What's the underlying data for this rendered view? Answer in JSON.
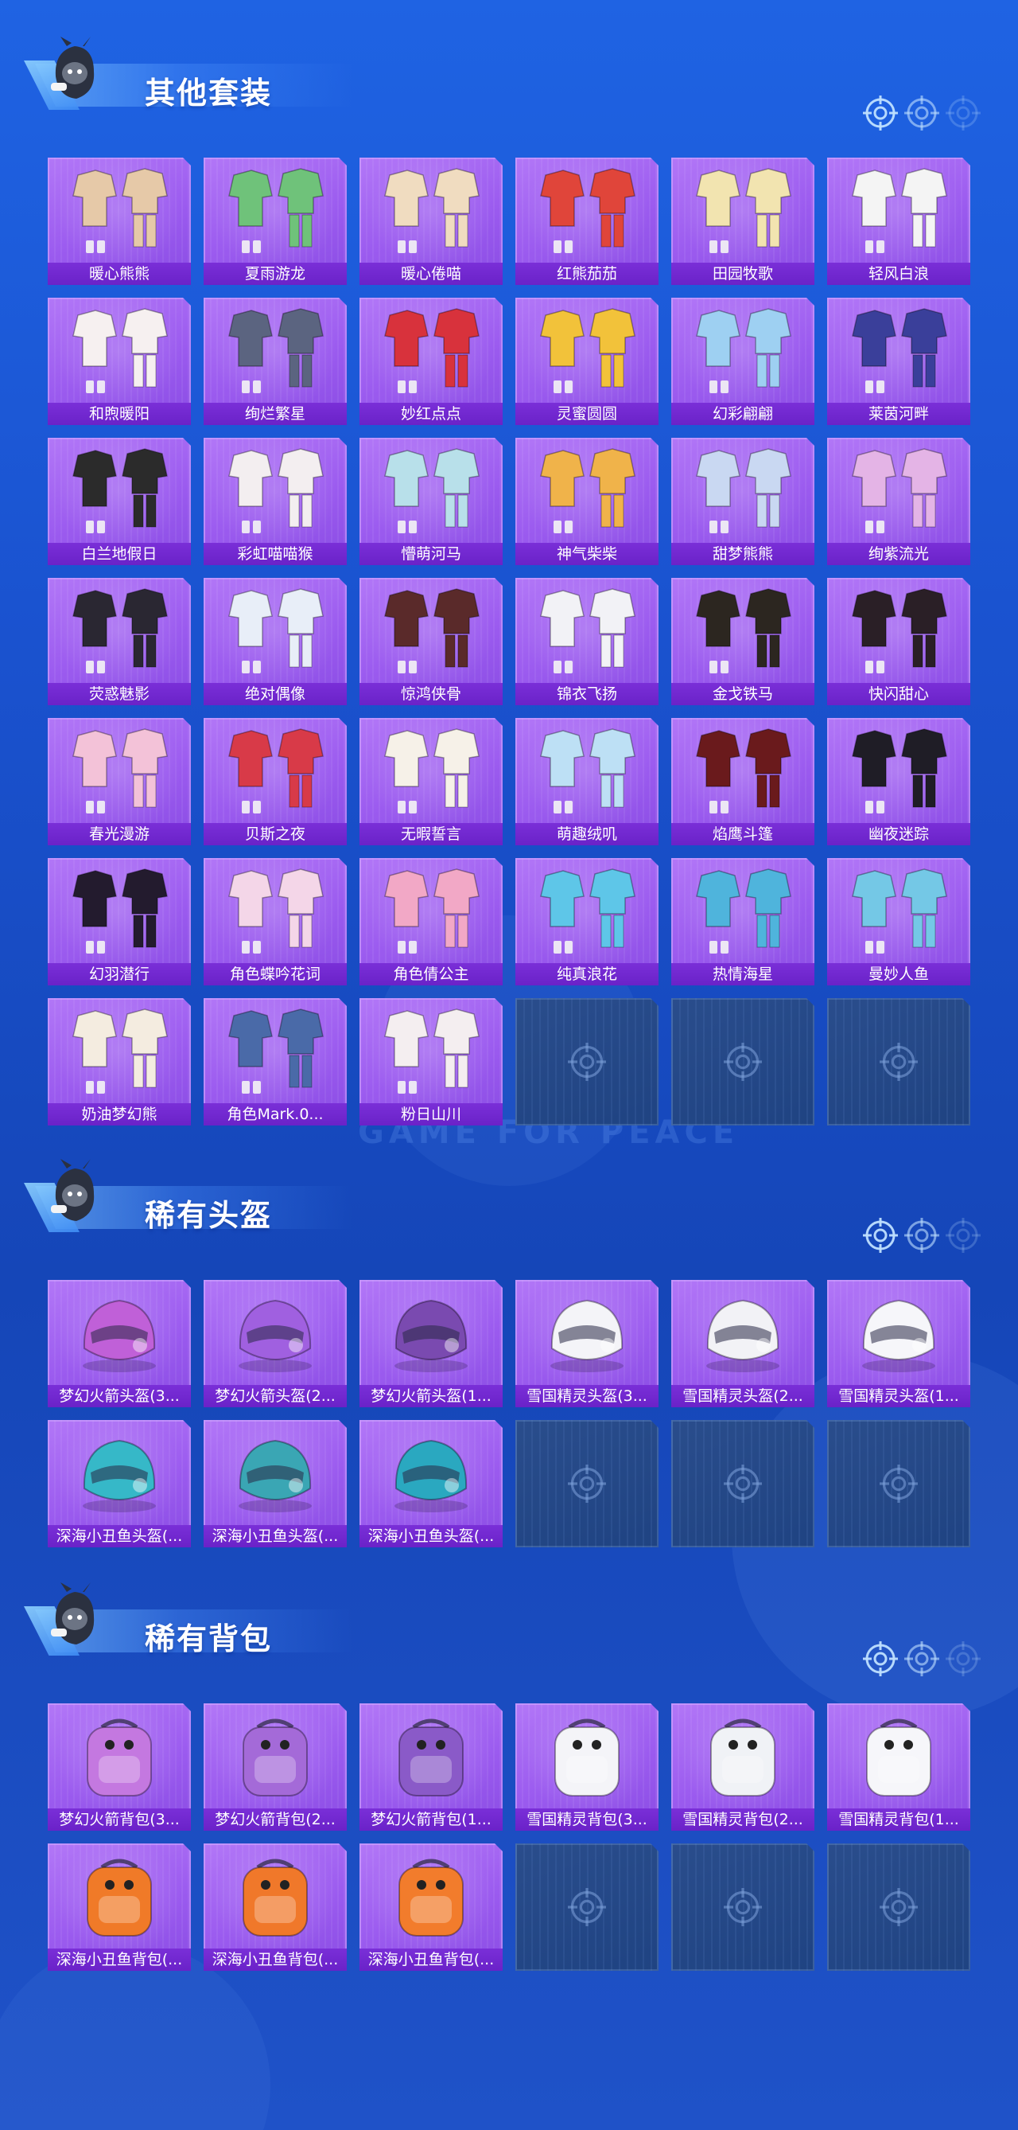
{
  "watermark": "GAME FOR PEACE",
  "sections": [
    {
      "title": "其他套装",
      "kind": "outfit",
      "items": [
        {
          "label": "暖心熊熊",
          "color": "#e6c9a8"
        },
        {
          "label": "夏雨游龙",
          "color": "#6fc27a"
        },
        {
          "label": "暖心倦喵",
          "color": "#f0dcc0"
        },
        {
          "label": "红熊茄茄",
          "color": "#e0453a"
        },
        {
          "label": "田园牧歌",
          "color": "#f2e4b0"
        },
        {
          "label": "轻风白浪",
          "color": "#f4f4f4"
        },
        {
          "label": "和煦暖阳",
          "color": "#f6f0f0"
        },
        {
          "label": "绚烂繁星",
          "color": "#5b6480"
        },
        {
          "label": "妙红点点",
          "color": "#d8323c"
        },
        {
          "label": "灵蜜圆圆",
          "color": "#f2c23a"
        },
        {
          "label": "幻彩翩翩",
          "color": "#9ed0f2"
        },
        {
          "label": "莱茵河畔",
          "color": "#3a3f9a"
        },
        {
          "label": "白兰地假日",
          "color": "#2b2b2b"
        },
        {
          "label": "彩虹喵喵猴",
          "color": "#f3eef0"
        },
        {
          "label": "懵萌河马",
          "color": "#b8e0ea"
        },
        {
          "label": "神气柴柴",
          "color": "#f0b34a"
        },
        {
          "label": "甜梦熊熊",
          "color": "#c9d8f2"
        },
        {
          "label": "绚紫流光",
          "color": "#e4b4e6"
        },
        {
          "label": "荧惑魅影",
          "color": "#2a2732"
        },
        {
          "label": "绝对偶像",
          "color": "#e8eef8"
        },
        {
          "label": "惊鸿侠骨",
          "color": "#5a2a2a"
        },
        {
          "label": "锦衣飞扬",
          "color": "#f2f2f6"
        },
        {
          "label": "金戈铁马",
          "color": "#2c2620"
        },
        {
          "label": "快闪甜心",
          "color": "#2a1f26"
        },
        {
          "label": "春光漫游",
          "color": "#f3c2d8"
        },
        {
          "label": "贝斯之夜",
          "color": "#d83a48"
        },
        {
          "label": "无暇誓言",
          "color": "#f6f1e8"
        },
        {
          "label": "萌趣绒叽",
          "color": "#bde0f5"
        },
        {
          "label": "焰鹰斗篷",
          "color": "#6a1a1c"
        },
        {
          "label": "幽夜迷踪",
          "color": "#1f1d26"
        },
        {
          "label": "幻羽潜行",
          "color": "#231b2e"
        },
        {
          "label": "角色蝶吟花词",
          "color": "#f4d6e8"
        },
        {
          "label": "角色倩公主",
          "color": "#f2a8c6"
        },
        {
          "label": "纯真浪花",
          "color": "#5ec6e8"
        },
        {
          "label": "热情海星",
          "color": "#4fb4dc"
        },
        {
          "label": "曼妙人鱼",
          "color": "#74c8e6"
        },
        {
          "label": "奶油梦幻熊",
          "color": "#f4ece0"
        },
        {
          "label": "角色Mark.0...",
          "color": "#4a6aa8"
        },
        {
          "label": "粉日山川",
          "color": "#f4eef0"
        },
        {
          "label": "",
          "empty": true
        },
        {
          "label": "",
          "empty": true
        },
        {
          "label": "",
          "empty": true
        }
      ]
    },
    {
      "title": "稀有头盔",
      "kind": "helmet",
      "items": [
        {
          "label": "梦幻火箭头盔(3...",
          "color": "#c060d8"
        },
        {
          "label": "梦幻火箭头盔(2...",
          "color": "#a060e0"
        },
        {
          "label": "梦幻火箭头盔(1...",
          "color": "#7a4ab0"
        },
        {
          "label": "雪国精灵头盔(3...",
          "color": "#f4f4f8"
        },
        {
          "label": "雪国精灵头盔(2...",
          "color": "#f2f2f6"
        },
        {
          "label": "雪国精灵头盔(1...",
          "color": "#f6f6fa"
        },
        {
          "label": "深海小丑鱼头盔(...",
          "color": "#36b8c8"
        },
        {
          "label": "深海小丑鱼头盔(...",
          "color": "#3aa6b4"
        },
        {
          "label": "深海小丑鱼头盔(...",
          "color": "#2aa8c0"
        },
        {
          "label": "",
          "empty": true
        },
        {
          "label": "",
          "empty": true
        },
        {
          "label": "",
          "empty": true
        }
      ]
    },
    {
      "title": "稀有背包",
      "kind": "backpack",
      "items": [
        {
          "label": "梦幻火箭背包(3...",
          "color": "#c478e0"
        },
        {
          "label": "梦幻火箭背包(2...",
          "color": "#a46ad8"
        },
        {
          "label": "梦幻火箭背包(1...",
          "color": "#8a5ac8"
        },
        {
          "label": "雪国精灵背包(3...",
          "color": "#f4f4f8"
        },
        {
          "label": "雪国精灵背包(2...",
          "color": "#f0f2f6"
        },
        {
          "label": "雪国精灵背包(1...",
          "color": "#f6f6fa"
        },
        {
          "label": "深海小丑鱼背包(...",
          "color": "#f07a28"
        },
        {
          "label": "深海小丑鱼背包(...",
          "color": "#f0782a"
        },
        {
          "label": "深海小丑鱼背包(...",
          "color": "#f27c2c"
        },
        {
          "label": "",
          "empty": true
        },
        {
          "label": "",
          "empty": true
        },
        {
          "label": "",
          "empty": true
        }
      ]
    }
  ]
}
